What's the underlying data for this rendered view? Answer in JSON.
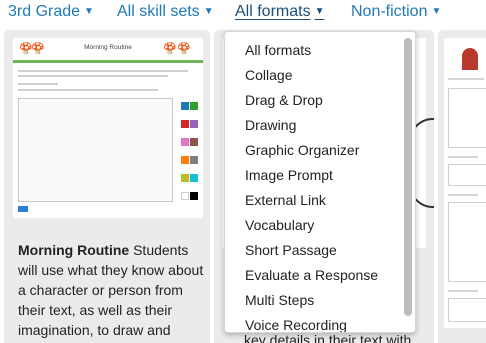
{
  "filters": [
    {
      "label": "3rd Grade",
      "active": false
    },
    {
      "label": "All skill sets",
      "active": false
    },
    {
      "label": "All formats",
      "active": true
    },
    {
      "label": "Non-fiction",
      "active": false
    }
  ],
  "card1": {
    "thumb_title": "Morning Routine",
    "title": "Morning Routine",
    "body": " Students will use what they know about a character or person from their text, as well as their imagination, to draw and explain that person's morning"
  },
  "card2": {
    "body_fragment": "key details in their text with"
  },
  "dropdown": {
    "options": [
      "All formats",
      "Collage",
      "Drag & Drop",
      "Drawing",
      "Graphic Organizer",
      "Image Prompt",
      "External Link",
      "Vocabulary",
      "Short Passage",
      "Evaluate a Response",
      "Multi Steps",
      "Voice Recording"
    ]
  },
  "colors": {
    "link": "#1f79b8",
    "card_bg": "#ebebeb"
  }
}
